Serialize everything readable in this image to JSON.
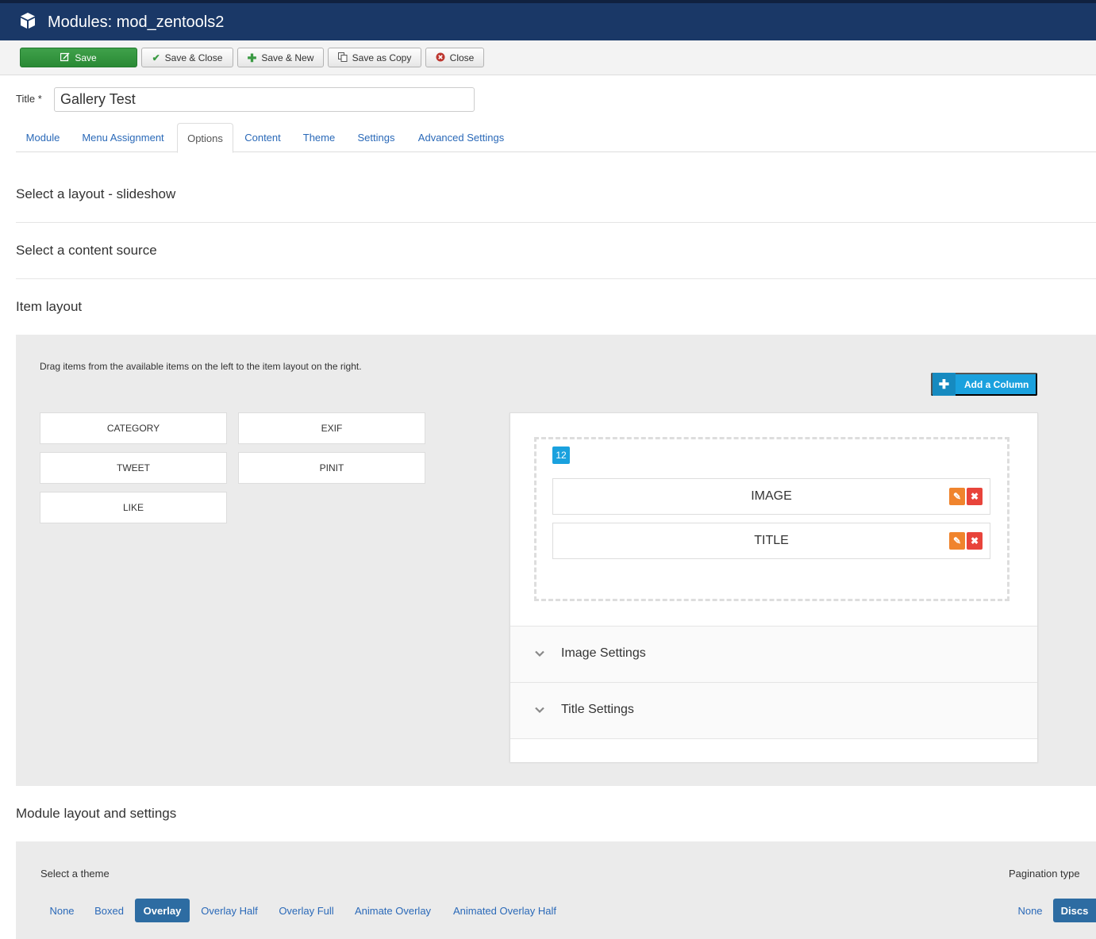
{
  "header": {
    "icon": "cube-icon",
    "title": "Modules: mod_zentools2"
  },
  "toolbar": {
    "save": "Save",
    "save_close": "Save & Close",
    "save_new": "Save & New",
    "save_copy": "Save as Copy",
    "close": "Close"
  },
  "form": {
    "title_label": "Title *",
    "title_value": "Gallery Test"
  },
  "tabs": [
    "Module",
    "Menu Assignment",
    "Options",
    "Content",
    "Theme",
    "Settings",
    "Advanced Settings"
  ],
  "active_tab": "Options",
  "sections": {
    "layout": "Select a layout - slideshow",
    "content_source": "Select a content source",
    "item_layout": "Item layout",
    "module_layout": "Module layout and settings"
  },
  "item_layout": {
    "hint": "Drag items from the available items on the left to the item layout on the right.",
    "add_column": "Add a Column",
    "available_items": [
      "CATEGORY",
      "EXIF",
      "TWEET",
      "PINIT",
      "LIKE"
    ],
    "column_width": "12",
    "layout_items": [
      "IMAGE",
      "TITLE"
    ],
    "accordions": [
      "Image Settings",
      "Title Settings"
    ]
  },
  "module_layout": {
    "theme_label": "Select a theme",
    "themes": [
      "None",
      "Boxed",
      "Overlay",
      "Overlay Half",
      "Overlay Full",
      "Animate Overlay",
      "Animated Overlay Half"
    ],
    "selected_theme": "Overlay",
    "pagination_label": "Pagination type",
    "pagination_options": [
      "None",
      "Discs"
    ],
    "selected_pagination": "Discs"
  },
  "colors": {
    "header_bg": "#1a3867",
    "save_green": "#2a8a35",
    "link_blue": "#2a69b8",
    "accent_cyan": "#1aa1de",
    "selected_blue": "#2d6ca2",
    "edit_orange": "#f0842d",
    "delete_red": "#e8443b"
  }
}
